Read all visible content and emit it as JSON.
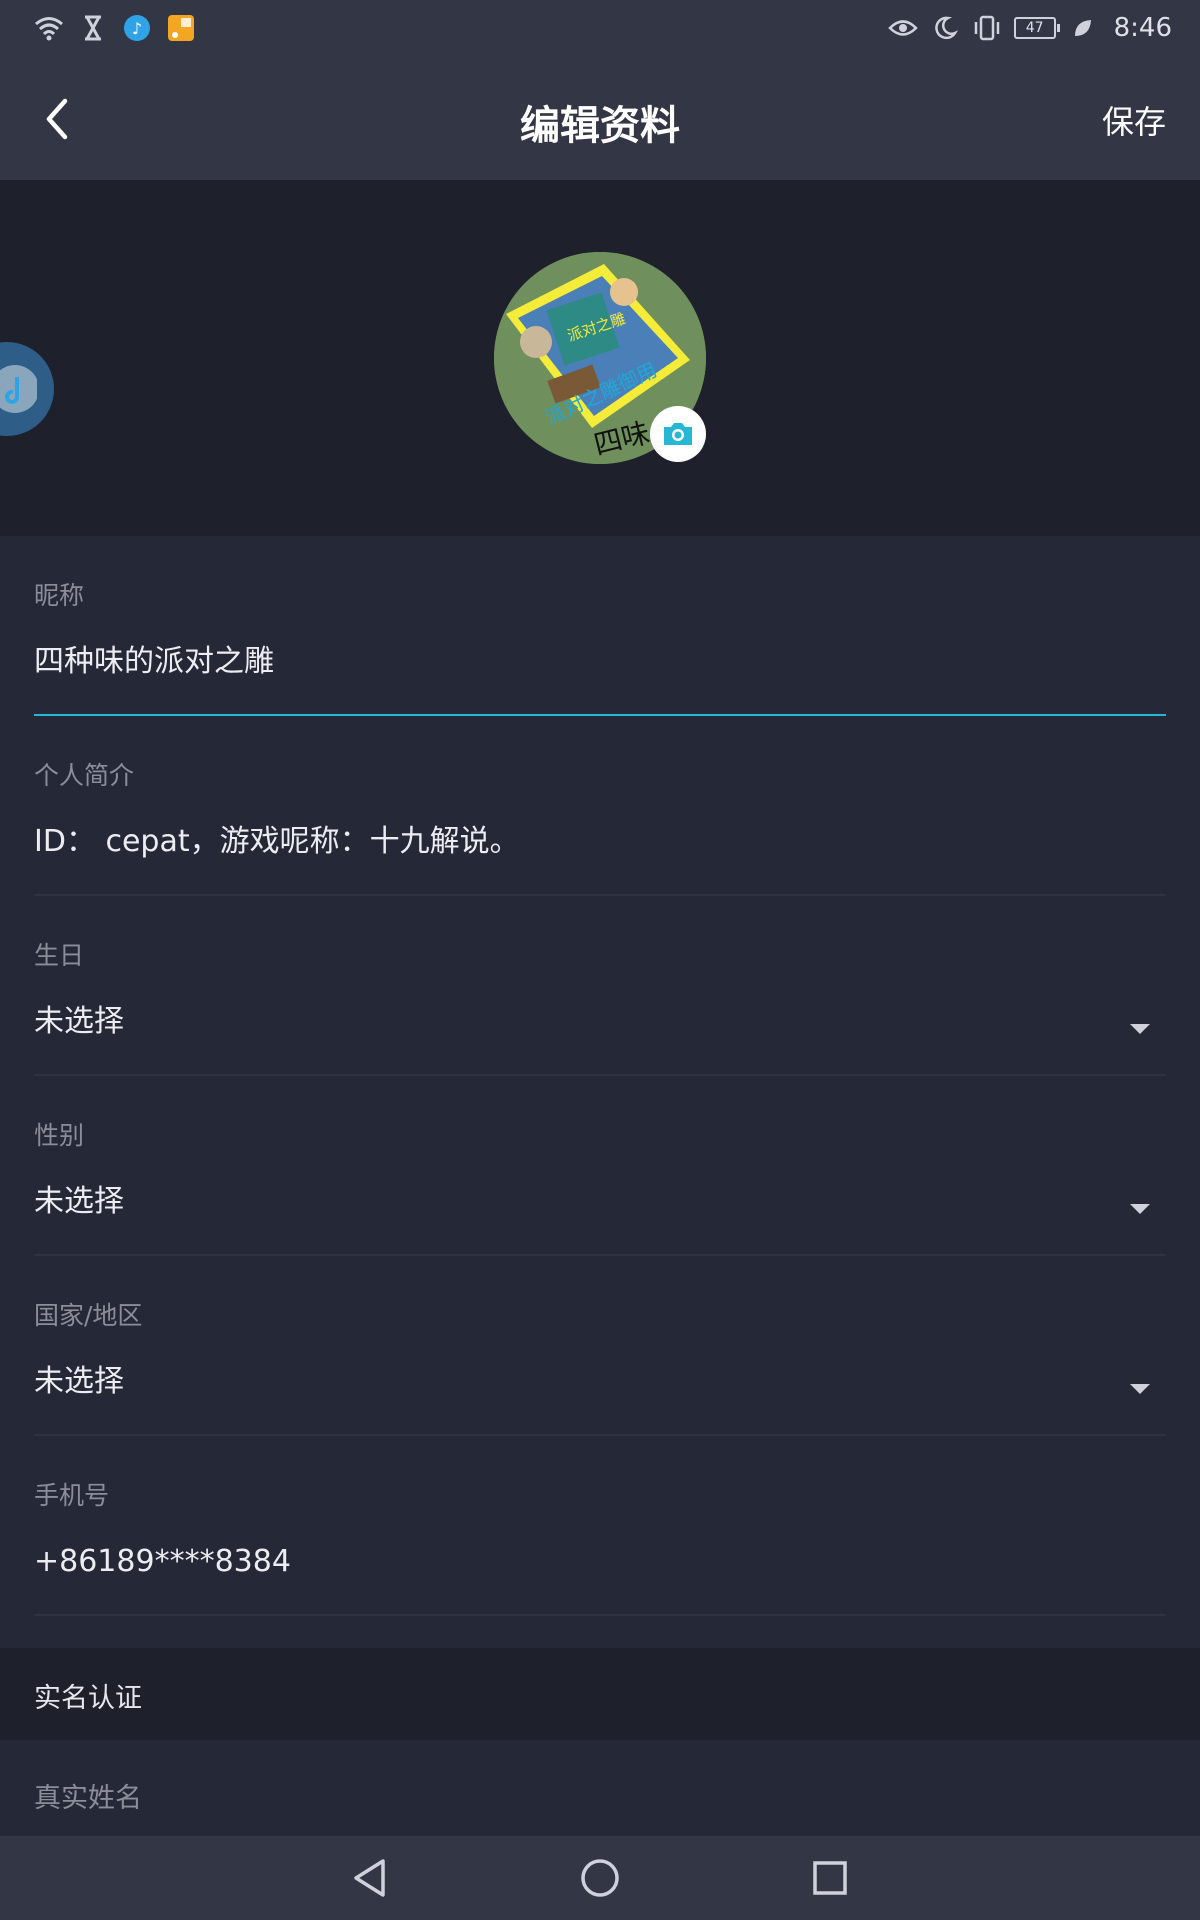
{
  "status_bar": {
    "time": "8:46",
    "battery": "47",
    "left_icons": [
      "wifi-icon",
      "hourglass-icon",
      "music-app-icon",
      "rss-app-icon"
    ],
    "right_icons": [
      "eye-icon",
      "moon-icon",
      "vibrate-icon",
      "battery-icon",
      "leaf-icon"
    ]
  },
  "header": {
    "title": "编辑资料",
    "save_label": "保存",
    "back_icon": "chevron-left-icon"
  },
  "avatar": {
    "image_text_top": "派对之雕",
    "image_text_banner": "派对之雕御用",
    "image_text_bottom": "四味",
    "camera_icon": "camera-icon"
  },
  "form": {
    "nickname": {
      "label": "昵称",
      "value": "四种味的派对之雕"
    },
    "bio": {
      "label": "个人简介",
      "value": "ID： cepat，游戏呢称：十九解说。"
    },
    "birthday": {
      "label": "生日",
      "value": "未选择"
    },
    "gender": {
      "label": "性别",
      "value": "未选择"
    },
    "region": {
      "label": "国家/地区",
      "value": "未选择"
    },
    "phone": {
      "label": "手机号",
      "value": "+86189****8384"
    }
  },
  "realname_section": {
    "title": "实名认证",
    "name_label": "真实姓名"
  },
  "colors": {
    "accent": "#25b7d3",
    "background": "#252836",
    "header": "#323645",
    "section": "#1e202b"
  }
}
